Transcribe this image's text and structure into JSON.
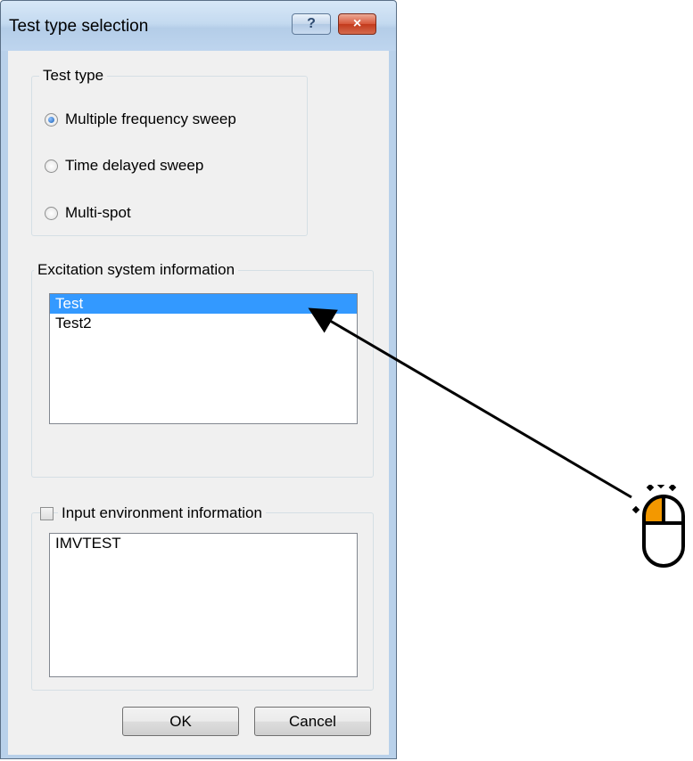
{
  "window": {
    "title": "Test type selection",
    "help_label": "?",
    "close_label": "×"
  },
  "test_type": {
    "label": "Test type",
    "options": [
      {
        "label": "Multiple frequency sweep",
        "checked": true
      },
      {
        "label": "Time delayed sweep",
        "checked": false
      },
      {
        "label": "Multi-spot",
        "checked": false
      }
    ]
  },
  "excitation": {
    "label": "Excitation system information",
    "items": [
      "Test",
      "Test2"
    ],
    "selected": "Test"
  },
  "environment": {
    "label": "Input environment information",
    "checked": false,
    "items": [
      "IMVTEST"
    ]
  },
  "buttons": {
    "ok": "OK",
    "cancel": "Cancel"
  },
  "annotation": {
    "icon": "mouse-click-icon",
    "arrow_color": "#000000",
    "accent_color": "#f39800"
  }
}
